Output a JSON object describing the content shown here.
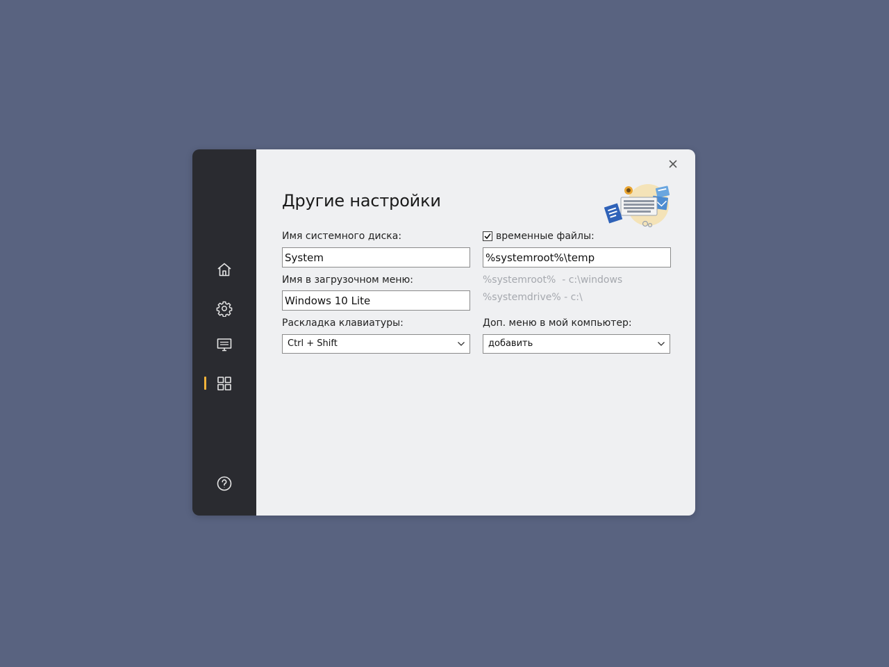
{
  "window": {
    "title": "Другие настройки"
  },
  "sidebar": {
    "items": [
      {
        "name": "home",
        "icon": "home-icon"
      },
      {
        "name": "settings",
        "icon": "gear-icon"
      },
      {
        "name": "display",
        "icon": "monitor-icon"
      },
      {
        "name": "apps",
        "icon": "grid-icon",
        "active": true
      },
      {
        "name": "help",
        "icon": "help-icon"
      }
    ],
    "accent_color": "#f2b33a",
    "background": "#2a2b30"
  },
  "form": {
    "system_disk_label": "Имя системного диска:",
    "system_disk_value": "System",
    "boot_menu_label": "Имя в загрузочном меню:",
    "boot_menu_value": "Windows 10 Lite",
    "keyboard_layout_label": "Раскладка клавиатуры:",
    "keyboard_layout_value": "Ctrl + Shift",
    "temp_files_label": "временные файлы:",
    "temp_files_checked": true,
    "temp_files_value": "%systemroot%\\temp",
    "hint_systemroot": "%systemroot%  - c:\\windows",
    "hint_systemdrive": "%systemdrive% - c:\\",
    "my_computer_menu_label": "Доп. меню в мой компьютер:",
    "my_computer_menu_value": "добавить"
  }
}
